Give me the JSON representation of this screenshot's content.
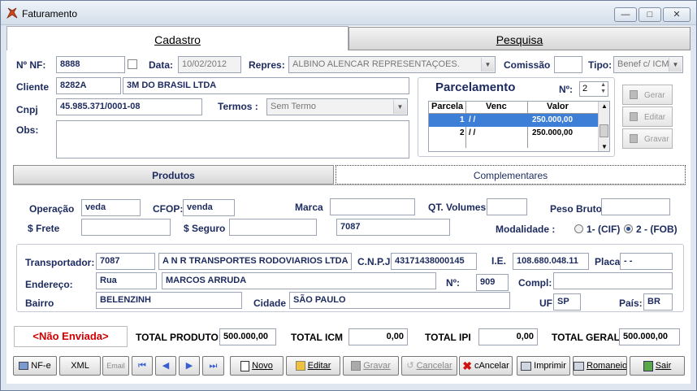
{
  "window": {
    "title": "Faturamento",
    "min": "▭",
    "max": "□",
    "close": "✕"
  },
  "tabs": {
    "main": [
      "Cadastro",
      "Pesquisa"
    ],
    "sub": [
      "Produtos",
      "Complementares"
    ]
  },
  "header": {
    "nf_label": "Nº NF:",
    "nf": "8888",
    "data_label": "Data:",
    "data": "10/02/2012",
    "repres_label": "Repres:",
    "repres": "ALBINO ALENCAR REPRESENTAÇOES.",
    "comissao_label": "Comissão",
    "comissao": "",
    "tipo_label": "Tipo:",
    "tipo": "Benef c/ ICM",
    "cliente_label": "Cliente",
    "cliente_cod": "8282A",
    "cliente_nome": "3M DO BRASIL LTDA",
    "cnpj_label": "Cnpj",
    "cnpj": "45.985.371/0001-08",
    "termos_label": "Termos :",
    "termos": "Sem Termo",
    "obs_label": "Obs:",
    "obs": ""
  },
  "parcelamento": {
    "title": "Parcelamento",
    "n_label": "Nº:",
    "n": "2",
    "columns": [
      "Parcela",
      "Venc",
      "Valor"
    ],
    "rows": [
      {
        "parcela": "1",
        "venc": "/ /",
        "valor": "250.000,00"
      },
      {
        "parcela": "2",
        "venc": "/ /",
        "valor": "250.000,00"
      }
    ],
    "buttons": [
      "Gerar",
      "Editar",
      "Gravar"
    ]
  },
  "complementares": {
    "operacao_label": "Operação",
    "operacao": "veda",
    "cfop_label": "CFOP:",
    "cfop": "venda",
    "marca_label": "Marca",
    "marca": "",
    "qt_volumes_label": "QT. Volumes",
    "qt_volumes": "",
    "peso_bruto_label": "Peso Bruto",
    "peso_bruto": "",
    "frete_label": "$ Frete",
    "frete": "",
    "seguro_label": "$ Seguro",
    "seguro": "",
    "extra": "7087",
    "modalidade_label": "Modalidade :",
    "modalidade_cif": "1- (CIF)",
    "modalidade_fob": "2 - (FOB)",
    "transportador_label": "Transportador:",
    "transportador_cod": "7087",
    "transportador_nome": "A N R TRANSPORTES RODOVIARIOS LTDA",
    "cnpj_label": "C.N.P.J.",
    "cnpj": "43171438000145",
    "ie_label": "I.E.",
    "ie": "108.680.048.11",
    "placa_label": "Placa",
    "placa": "- -",
    "endereco_label": "Endereço:",
    "endereco_tipo": "Rua",
    "endereco": "MARCOS ARRUDA",
    "numero_label": "Nº:",
    "numero": "909",
    "compl_label": "Compl:",
    "compl": "",
    "bairro_label": "Bairro",
    "bairro": "BELENZINH",
    "cidade_label": "Cidade",
    "cidade": "SÃO PAULO",
    "uf_label": "UF:",
    "uf": "SP",
    "pais_label": "País:",
    "pais": "BR"
  },
  "totais": {
    "status": "<Não Enviada>",
    "produto_label": "TOTAL PRODUTO",
    "produto": "500.000,00",
    "icm_label": "TOTAL ICM",
    "icm": "0,00",
    "ipi_label": "TOTAL IPI",
    "ipi": "0,00",
    "geral_label": "TOTAL GERAL",
    "geral": "500.000,00"
  },
  "toolbar": {
    "nfe": "NF-e",
    "xml": "XML",
    "email": "Email",
    "novo": "Novo",
    "editar": "Editar",
    "gravar": "Gravar",
    "cancelar_dis": "Cancelar",
    "cancelar": "cAncelar",
    "imprimir": "Imprimir",
    "romaneio": "Romaneio",
    "sair": "Sair"
  },
  "colors": {
    "label": "#1c2a5e",
    "status": "#d00000",
    "selection": "#3d7fd6"
  }
}
